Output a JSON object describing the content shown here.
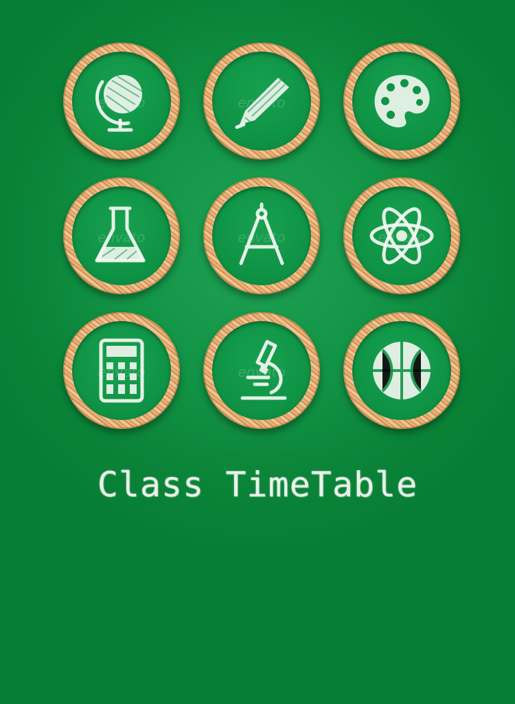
{
  "title": "Class TimeTable",
  "watermark": "envato",
  "colors": {
    "board": "#0a8438",
    "tile_face": "#0f9446",
    "wood": "#e0a469",
    "chalk": "#f4f7f2"
  },
  "subjects": [
    {
      "icon": "globe-icon"
    },
    {
      "icon": "pencil-icon"
    },
    {
      "icon": "paint-palette-icon"
    },
    {
      "icon": "flask-icon"
    },
    {
      "icon": "drawing-compass-icon"
    },
    {
      "icon": "atom-icon"
    },
    {
      "icon": "calculator-icon"
    },
    {
      "icon": "microscope-icon"
    },
    {
      "icon": "basketball-icon"
    }
  ]
}
